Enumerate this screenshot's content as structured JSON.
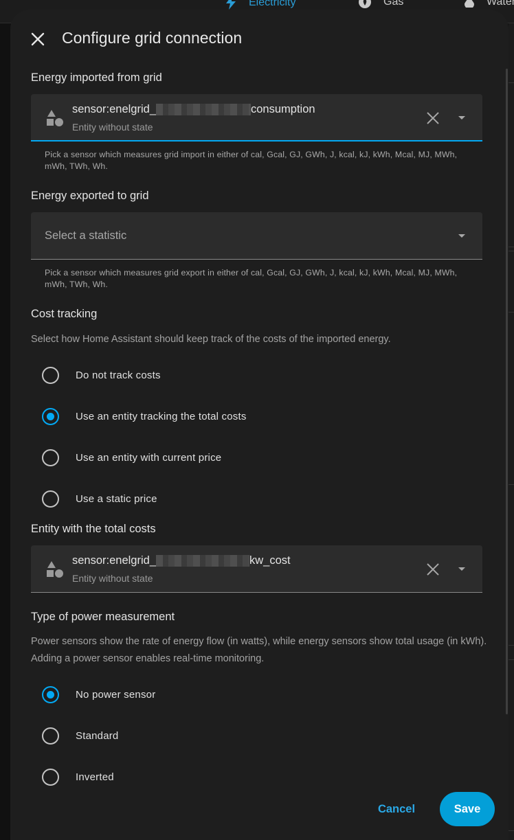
{
  "background": {
    "tabs": [
      {
        "label": "Electricity",
        "icon": "lightning-icon",
        "color": "#2a9cd5"
      },
      {
        "label": "Gas",
        "icon": "flame-icon",
        "color": "#c9c9c9"
      },
      {
        "label": "Water",
        "icon": "water-drop-icon",
        "color": "#c9c9c9"
      }
    ]
  },
  "dialog": {
    "title": "Configure grid connection",
    "close_icon": "close-icon",
    "import": {
      "label": "Energy imported from grid",
      "value_prefix": "sensor:enelgrid_",
      "value_suffix": "consumption",
      "sub": "Entity without state",
      "helper": "Pick a sensor which measures grid import in either of cal, Gcal, GJ, GWh, J, kcal, kJ, kWh, Mcal, MJ, MWh, mWh, TWh, Wh."
    },
    "export": {
      "label": "Energy exported to grid",
      "placeholder": "Select a statistic",
      "helper": "Pick a sensor which measures grid export in either of cal, Gcal, GJ, GWh, J, kcal, kJ, kWh, Mcal, MJ, MWh, mWh, TWh, Wh."
    },
    "cost": {
      "label": "Cost tracking",
      "description": "Select how Home Assistant should keep track of the costs of the imported energy.",
      "options": [
        {
          "label": "Do not track costs",
          "checked": false
        },
        {
          "label": "Use an entity tracking the total costs",
          "checked": true
        },
        {
          "label": "Use an entity with current price",
          "checked": false
        },
        {
          "label": "Use a static price",
          "checked": false
        }
      ]
    },
    "total_costs": {
      "label": "Entity with the total costs",
      "value_prefix": "sensor:enelgrid_",
      "value_suffix": "kw_cost",
      "sub": "Entity without state"
    },
    "power": {
      "label": "Type of power measurement",
      "description": "Power sensors show the rate of energy flow (in watts), while energy sensors show total usage (in kWh). Adding a power sensor enables real-time monitoring.",
      "options": [
        {
          "label": "No power sensor",
          "checked": true
        },
        {
          "label": "Standard",
          "checked": false
        },
        {
          "label": "Inverted",
          "checked": false
        }
      ]
    },
    "actions": {
      "cancel": "Cancel",
      "save": "Save"
    },
    "accent_color": "#03a9f4"
  }
}
